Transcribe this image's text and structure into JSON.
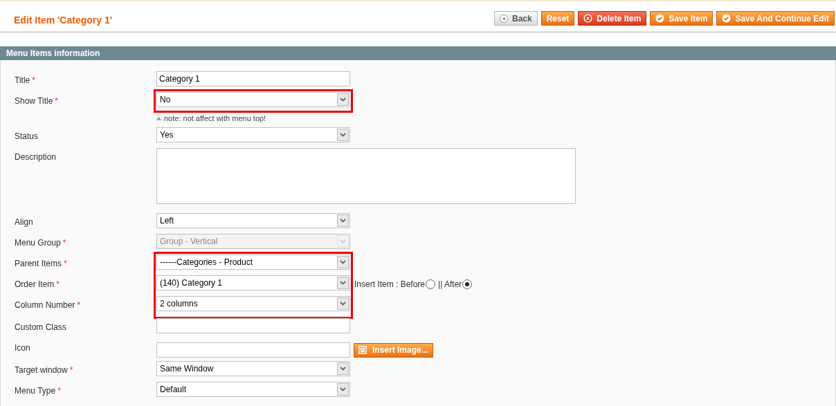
{
  "header": {
    "title": "Edit Item 'Category 1'",
    "buttons": [
      {
        "label": "Back",
        "kind": "back"
      },
      {
        "label": "Reset",
        "kind": "plain"
      },
      {
        "label": "Delete Item",
        "kind": "delete"
      },
      {
        "label": "Save Item",
        "kind": "save"
      },
      {
        "label": "Save And Continue Edit",
        "kind": "save"
      }
    ]
  },
  "section": {
    "title": "Menu Items information"
  },
  "fields": [
    {
      "label": "Title",
      "mark": "*",
      "kind": "text",
      "value": "Category 1",
      "highlighted": false
    },
    {
      "label": "Show Title",
      "mark": "*",
      "kind": "select",
      "value": "No",
      "highlighted": true,
      "note": "note: not affect with menu top!"
    },
    {
      "label": "Status",
      "kind": "select",
      "value": "Yes",
      "highlighted": false
    },
    {
      "label": "Description",
      "kind": "textarea",
      "highlighted": false
    },
    {
      "label": "Align",
      "kind": "select",
      "value": "Left",
      "highlighted": false
    },
    {
      "label": "Menu Group",
      "mark": "*",
      "kind": "select",
      "value": "Group - Vertical",
      "disabled": true,
      "highlighted": false
    },
    {
      "label": "Parent Items",
      "mark": "*",
      "kind": "select",
      "value": "------Categories - Product",
      "highlighted": true
    },
    {
      "label": "Order Item",
      "mark": "*",
      "kind": "select",
      "value": "(140) Category 1",
      "highlighted": true,
      "radios": [
        {
          "label": "Insert Item : Before",
          "selected": false
        },
        {
          "label": "|| After",
          "selected": true
        }
      ]
    },
    {
      "label": "Column Number",
      "mark": "*",
      "kind": "select",
      "value": "2 columns",
      "highlighted": true
    },
    {
      "label": "Custom Class",
      "kind": "text",
      "highlighted": false
    },
    {
      "label": "Icon",
      "kind": "image",
      "highlighted": false,
      "button": "Insert Image..."
    },
    {
      "label": "Target window",
      "mark": "*",
      "kind": "select",
      "value": "Same Window",
      "highlighted": false
    },
    {
      "label": "Menu Type",
      "mark": "*",
      "kind": "select",
      "value": "Default",
      "highlighted": false
    }
  ]
}
